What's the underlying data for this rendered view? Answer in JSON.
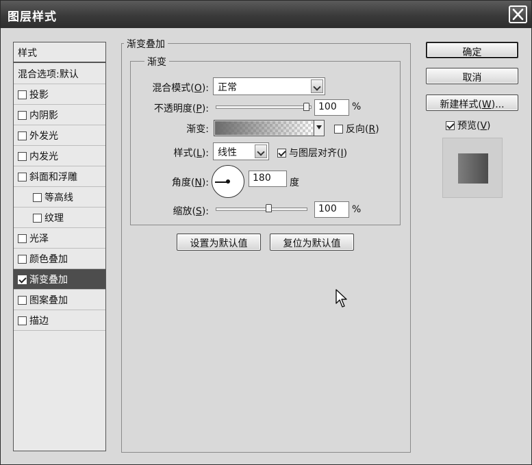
{
  "dialog": {
    "title": "图层样式"
  },
  "sidebar": {
    "header": "样式",
    "items": [
      {
        "label": "混合选项:默认",
        "checkbox": false,
        "checked": false,
        "sub": false,
        "selected": false
      },
      {
        "label": "投影",
        "checkbox": true,
        "checked": false,
        "sub": false,
        "selected": false
      },
      {
        "label": "内阴影",
        "checkbox": true,
        "checked": false,
        "sub": false,
        "selected": false
      },
      {
        "label": "外发光",
        "checkbox": true,
        "checked": false,
        "sub": false,
        "selected": false
      },
      {
        "label": "内发光",
        "checkbox": true,
        "checked": false,
        "sub": false,
        "selected": false
      },
      {
        "label": "斜面和浮雕",
        "checkbox": true,
        "checked": false,
        "sub": false,
        "selected": false
      },
      {
        "label": "等高线",
        "checkbox": true,
        "checked": false,
        "sub": true,
        "selected": false
      },
      {
        "label": "纹理",
        "checkbox": true,
        "checked": false,
        "sub": true,
        "selected": false
      },
      {
        "label": "光泽",
        "checkbox": true,
        "checked": false,
        "sub": false,
        "selected": false
      },
      {
        "label": "颜色叠加",
        "checkbox": true,
        "checked": false,
        "sub": false,
        "selected": false
      },
      {
        "label": "渐变叠加",
        "checkbox": true,
        "checked": true,
        "sub": false,
        "selected": true
      },
      {
        "label": "图案叠加",
        "checkbox": true,
        "checked": false,
        "sub": false,
        "selected": false
      },
      {
        "label": "描边",
        "checkbox": true,
        "checked": false,
        "sub": false,
        "selected": false
      }
    ]
  },
  "panel": {
    "group_title": "渐变叠加",
    "subgroup_title": "渐变",
    "blend_mode": {
      "label_pre": "混合模式(",
      "mnemonic": "O",
      "label_post": "):",
      "value": "正常"
    },
    "opacity": {
      "label_pre": "不透明度(",
      "mnemonic": "P",
      "label_post": "):",
      "value": "100",
      "unit": "%",
      "level": 1.0
    },
    "gradient": {
      "label": "渐变:",
      "reverse_label_pre": "反向(",
      "reverse_mnemonic": "R",
      "reverse_label_post": ")",
      "reverse_checked": false
    },
    "style": {
      "label_pre": "样式(",
      "mnemonic": "L",
      "label_post": "):",
      "value": "线性",
      "align_label_pre": "与图层对齐(",
      "align_mnemonic": "I",
      "align_label_post": ")",
      "align_checked": true
    },
    "angle": {
      "label_pre": "角度(",
      "mnemonic": "N",
      "label_post": "):",
      "value": "180",
      "unit": "度"
    },
    "scale": {
      "label_pre": "缩放(",
      "mnemonic": "S",
      "label_post": "):",
      "value": "100",
      "unit": "%",
      "level": 0.6
    },
    "make_default": "设置为默认值",
    "reset_default": "复位为默认值"
  },
  "actions": {
    "ok": "确定",
    "cancel": "取消",
    "new_style_pre": "新建样式(",
    "new_style_mnemonic": "W",
    "new_style_post": ")...",
    "preview_pre": "预览(",
    "preview_mnemonic": "V",
    "preview_post": ")",
    "preview_checked": true
  },
  "icons": {
    "close": "close-icon",
    "cursor": "mouse-pointer-icon"
  }
}
